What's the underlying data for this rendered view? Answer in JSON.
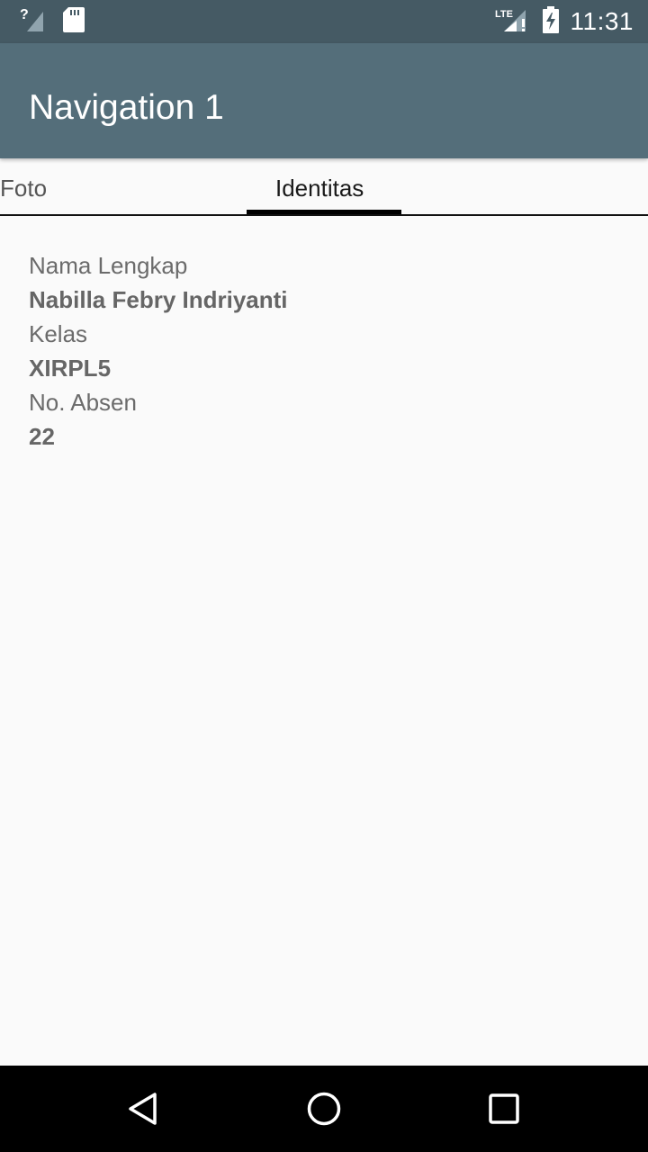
{
  "status_bar": {
    "time": "11:31",
    "network_label": "LTE",
    "icons": [
      "signal-unknown-icon",
      "sd-card-icon",
      "lte-signal-icon",
      "battery-charging-icon"
    ]
  },
  "app_bar": {
    "title": "Navigation 1",
    "color": "#546e7a"
  },
  "tabs": [
    {
      "label": "Foto",
      "selected": false
    },
    {
      "label": "Identitas",
      "selected": true
    }
  ],
  "identity": [
    {
      "label": "Nama Lengkap",
      "value": "Nabilla Febry Indriyanti"
    },
    {
      "label": "Kelas",
      "value": "XIRPL5"
    },
    {
      "label": "No. Absen",
      "value": "22"
    }
  ],
  "nav_bar": {
    "buttons": [
      "back-icon",
      "home-icon",
      "recent-apps-icon"
    ]
  }
}
